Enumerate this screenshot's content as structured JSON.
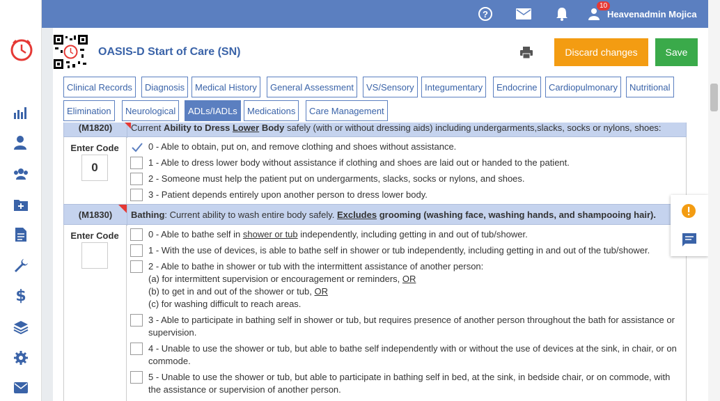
{
  "topbar": {
    "notifications_count": "10",
    "user_name": "Heavenadmin Mojica"
  },
  "header": {
    "title": "OASIS-D Start of Care (SN)",
    "discard_label": "Discard changes",
    "save_label": "Save"
  },
  "tabs": [
    {
      "label": "Clinical Records"
    },
    {
      "label": "Diagnosis"
    },
    {
      "label": "Medical History"
    },
    {
      "label": "General Assessment"
    },
    {
      "label": "VS/Sensory"
    },
    {
      "label": "Integumentary"
    },
    {
      "label": "Endocrine"
    },
    {
      "label": "Cardiopulmonary"
    },
    {
      "label": "Nutritional"
    },
    {
      "label": "Elimination"
    },
    {
      "label": "Neurological"
    },
    {
      "label": "ADLs/IADLs",
      "active": true
    },
    {
      "label": "Medications"
    },
    {
      "label": "Care Management"
    }
  ],
  "m1820": {
    "code": "(M1820)",
    "q_prefix": "Current ",
    "q_bold1": "Ability to Dress ",
    "q_bold_u": "Lower",
    "q_bold2": " Body",
    "q_rest": " safely (with or without dressing aids) including undergarments,slacks, socks or nylons, shoes:",
    "enter_code_label": "Enter Code",
    "value": "0",
    "options": [
      "0 - Able to obtain, put on, and remove clothing and shoes without assistance.",
      "1 - Able to dress lower body without assistance if clothing and shoes are laid out or handed to the patient.",
      "2 - Someone must help the patient put on undergarments, slacks, socks or nylons, and shoes.",
      "3 - Patient depends entirely upon another person to dress lower body."
    ]
  },
  "m1830": {
    "code": "(M1830)",
    "q_bold1": "Bathing",
    "q_mid": ": Current ability to wash entire body safely. ",
    "q_bold_u": "Excludes",
    "q_bold2": " grooming (washing face, washing hands, and shampooing hair).",
    "enter_code_label": "Enter Code",
    "value": "",
    "opt0_a": "0 - Able to bathe self in ",
    "opt0_u": "shower or tub",
    "opt0_b": " independently, including getting in and out of tub/shower.",
    "opt1": "1 - With the use of devices, is able to bathe self in shower or tub independently, including getting in and out of the tub/shower.",
    "opt2_l1": "2 - Able to bathe in shower or tub with the intermittent assistance of another person:",
    "opt2_l2a": "(a) for intermittent supervision or encouragement or reminders, ",
    "opt2_l2u": "OR",
    "opt2_l3a": "(b) to get in and out of the shower or tub, ",
    "opt2_l3u": "OR",
    "opt2_l4": "(c) for washing difficult to reach areas.",
    "opt3": "3 - Able to participate in bathing self in shower or tub, but requires presence of another person throughout the bath for assistance or supervision.",
    "opt4": "4 - Unable to use the shower or tub, but able to bathe self independently with or without the use of devices at the sink, in chair, or on commode.",
    "opt5": "5 - Unable to use the shower or tub, but able to participate in bathing self in bed, at the sink, in bedside chair, or on commode, with the assistance or supervision of another person."
  },
  "colors": {
    "topbar": "#5b7fc0",
    "accent": "#3a63a8",
    "discard": "#f39c12",
    "save": "#3aaa4a",
    "row_header": "#c5d3ee"
  }
}
